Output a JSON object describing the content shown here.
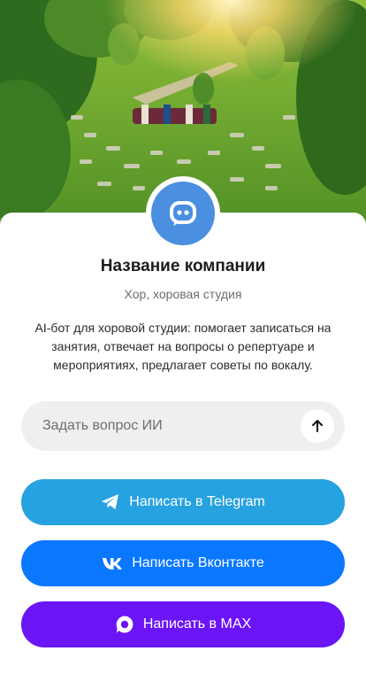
{
  "hero": {
    "image": "choir-in-park-photo"
  },
  "profile": {
    "avatar_icon": "chat-bot-icon",
    "company_name": "Название компании",
    "company_type": "Хор, хоровая студия",
    "description": "AI-бот для хоровой студии: помогает записаться на занятия, отвечает на вопросы о репертуаре и мероприятиях, предлагает советы по вокалу."
  },
  "ask": {
    "placeholder": "Задать вопрос ИИ",
    "value": "",
    "send_icon": "arrow-up-icon"
  },
  "actions": [
    {
      "label": "Написать в Telegram",
      "icon": "telegram-icon",
      "color": "#27a2e0"
    },
    {
      "label": "Написать Вконтакте",
      "icon": "vk-icon",
      "color": "#0a77ff"
    },
    {
      "label": "Написать в MAX",
      "icon": "max-icon",
      "color": "#6b14f5"
    }
  ],
  "colors": {
    "accent": "#4a8fe0",
    "background": "#ffffff",
    "input_bg": "#efefef"
  }
}
